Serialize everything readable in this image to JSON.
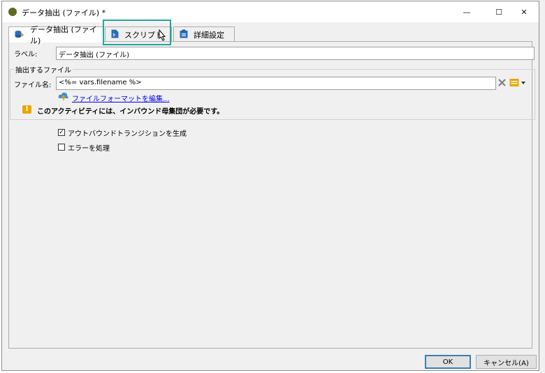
{
  "window": {
    "title": "データ抽出 (ファイル) *",
    "minimize": "—",
    "maximize": "☐",
    "close": "✕"
  },
  "tabs": [
    {
      "label": "データ抽出 (ファイル)",
      "icon": "database-export-icon"
    },
    {
      "label": "スクリプト",
      "icon": "script-file-icon"
    },
    {
      "label": "詳細設定",
      "icon": "clipboard-icon"
    }
  ],
  "form": {
    "label_caption": "ラベル:",
    "label_value": "データ抽出 (ファイル)",
    "group_title": "抽出するファイル",
    "filename_caption": "ファイル名:",
    "filename_value": "<%= vars.filename %>",
    "edit_format_link": "ファイルフォーマットを編集...",
    "warning_text": "このアクティビティには、インバウンド母集団が必要です。",
    "warning_icon": "!"
  },
  "options": [
    {
      "label": "アウトバウンドトランジションを生成",
      "checked": true
    },
    {
      "label": "エラーを処理",
      "checked": false
    }
  ],
  "buttons": {
    "ok": "OK",
    "cancel": "キャンセル(A)"
  },
  "colors": {
    "highlight": "#1aaa9a",
    "app_icon": "#5c6b1f",
    "link": "#0000ee",
    "warning": "#e8a600"
  }
}
